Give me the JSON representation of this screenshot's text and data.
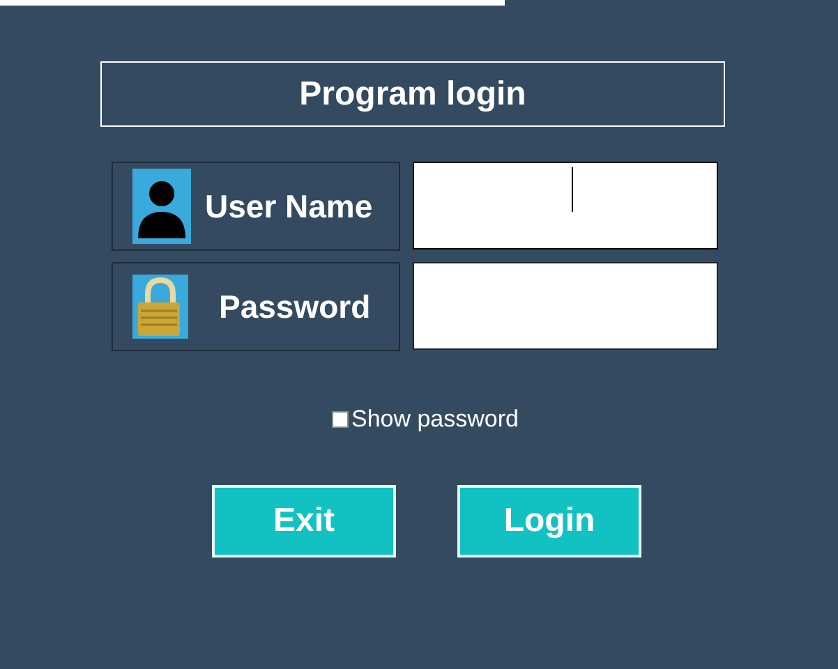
{
  "title": "Program login",
  "fields": [
    {
      "kind": "user",
      "label": "User Name",
      "focused": true
    },
    {
      "kind": "password",
      "label": "Password",
      "focused": false
    }
  ],
  "show_password": {
    "label": "Show password",
    "checked": false
  },
  "buttons": [
    {
      "label": "Exit"
    },
    {
      "label": "Login"
    }
  ]
}
